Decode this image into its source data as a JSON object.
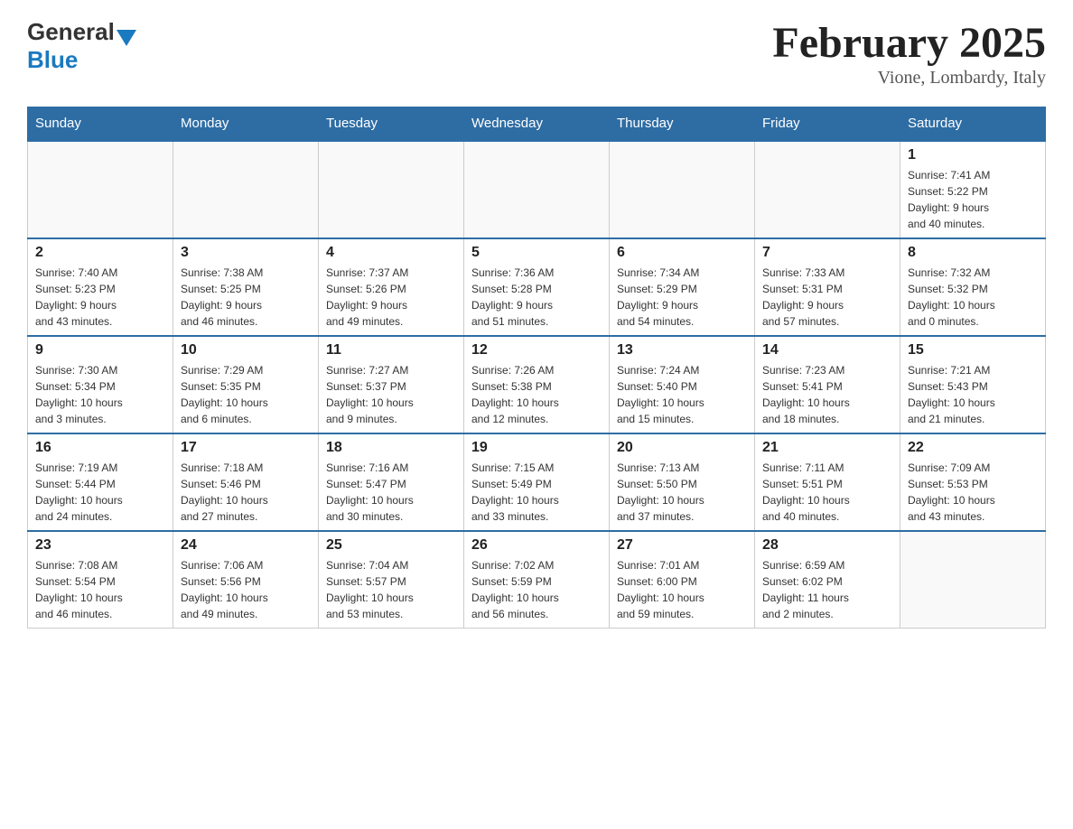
{
  "header": {
    "logo_general": "General",
    "logo_blue": "Blue",
    "month_title": "February 2025",
    "location": "Vione, Lombardy, Italy"
  },
  "weekdays": [
    "Sunday",
    "Monday",
    "Tuesday",
    "Wednesday",
    "Thursday",
    "Friday",
    "Saturday"
  ],
  "weeks": [
    [
      {
        "day": "",
        "info": ""
      },
      {
        "day": "",
        "info": ""
      },
      {
        "day": "",
        "info": ""
      },
      {
        "day": "",
        "info": ""
      },
      {
        "day": "",
        "info": ""
      },
      {
        "day": "",
        "info": ""
      },
      {
        "day": "1",
        "info": "Sunrise: 7:41 AM\nSunset: 5:22 PM\nDaylight: 9 hours\nand 40 minutes."
      }
    ],
    [
      {
        "day": "2",
        "info": "Sunrise: 7:40 AM\nSunset: 5:23 PM\nDaylight: 9 hours\nand 43 minutes."
      },
      {
        "day": "3",
        "info": "Sunrise: 7:38 AM\nSunset: 5:25 PM\nDaylight: 9 hours\nand 46 minutes."
      },
      {
        "day": "4",
        "info": "Sunrise: 7:37 AM\nSunset: 5:26 PM\nDaylight: 9 hours\nand 49 minutes."
      },
      {
        "day": "5",
        "info": "Sunrise: 7:36 AM\nSunset: 5:28 PM\nDaylight: 9 hours\nand 51 minutes."
      },
      {
        "day": "6",
        "info": "Sunrise: 7:34 AM\nSunset: 5:29 PM\nDaylight: 9 hours\nand 54 minutes."
      },
      {
        "day": "7",
        "info": "Sunrise: 7:33 AM\nSunset: 5:31 PM\nDaylight: 9 hours\nand 57 minutes."
      },
      {
        "day": "8",
        "info": "Sunrise: 7:32 AM\nSunset: 5:32 PM\nDaylight: 10 hours\nand 0 minutes."
      }
    ],
    [
      {
        "day": "9",
        "info": "Sunrise: 7:30 AM\nSunset: 5:34 PM\nDaylight: 10 hours\nand 3 minutes."
      },
      {
        "day": "10",
        "info": "Sunrise: 7:29 AM\nSunset: 5:35 PM\nDaylight: 10 hours\nand 6 minutes."
      },
      {
        "day": "11",
        "info": "Sunrise: 7:27 AM\nSunset: 5:37 PM\nDaylight: 10 hours\nand 9 minutes."
      },
      {
        "day": "12",
        "info": "Sunrise: 7:26 AM\nSunset: 5:38 PM\nDaylight: 10 hours\nand 12 minutes."
      },
      {
        "day": "13",
        "info": "Sunrise: 7:24 AM\nSunset: 5:40 PM\nDaylight: 10 hours\nand 15 minutes."
      },
      {
        "day": "14",
        "info": "Sunrise: 7:23 AM\nSunset: 5:41 PM\nDaylight: 10 hours\nand 18 minutes."
      },
      {
        "day": "15",
        "info": "Sunrise: 7:21 AM\nSunset: 5:43 PM\nDaylight: 10 hours\nand 21 minutes."
      }
    ],
    [
      {
        "day": "16",
        "info": "Sunrise: 7:19 AM\nSunset: 5:44 PM\nDaylight: 10 hours\nand 24 minutes."
      },
      {
        "day": "17",
        "info": "Sunrise: 7:18 AM\nSunset: 5:46 PM\nDaylight: 10 hours\nand 27 minutes."
      },
      {
        "day": "18",
        "info": "Sunrise: 7:16 AM\nSunset: 5:47 PM\nDaylight: 10 hours\nand 30 minutes."
      },
      {
        "day": "19",
        "info": "Sunrise: 7:15 AM\nSunset: 5:49 PM\nDaylight: 10 hours\nand 33 minutes."
      },
      {
        "day": "20",
        "info": "Sunrise: 7:13 AM\nSunset: 5:50 PM\nDaylight: 10 hours\nand 37 minutes."
      },
      {
        "day": "21",
        "info": "Sunrise: 7:11 AM\nSunset: 5:51 PM\nDaylight: 10 hours\nand 40 minutes."
      },
      {
        "day": "22",
        "info": "Sunrise: 7:09 AM\nSunset: 5:53 PM\nDaylight: 10 hours\nand 43 minutes."
      }
    ],
    [
      {
        "day": "23",
        "info": "Sunrise: 7:08 AM\nSunset: 5:54 PM\nDaylight: 10 hours\nand 46 minutes."
      },
      {
        "day": "24",
        "info": "Sunrise: 7:06 AM\nSunset: 5:56 PM\nDaylight: 10 hours\nand 49 minutes."
      },
      {
        "day": "25",
        "info": "Sunrise: 7:04 AM\nSunset: 5:57 PM\nDaylight: 10 hours\nand 53 minutes."
      },
      {
        "day": "26",
        "info": "Sunrise: 7:02 AM\nSunset: 5:59 PM\nDaylight: 10 hours\nand 56 minutes."
      },
      {
        "day": "27",
        "info": "Sunrise: 7:01 AM\nSunset: 6:00 PM\nDaylight: 10 hours\nand 59 minutes."
      },
      {
        "day": "28",
        "info": "Sunrise: 6:59 AM\nSunset: 6:02 PM\nDaylight: 11 hours\nand 2 minutes."
      },
      {
        "day": "",
        "info": ""
      }
    ]
  ]
}
